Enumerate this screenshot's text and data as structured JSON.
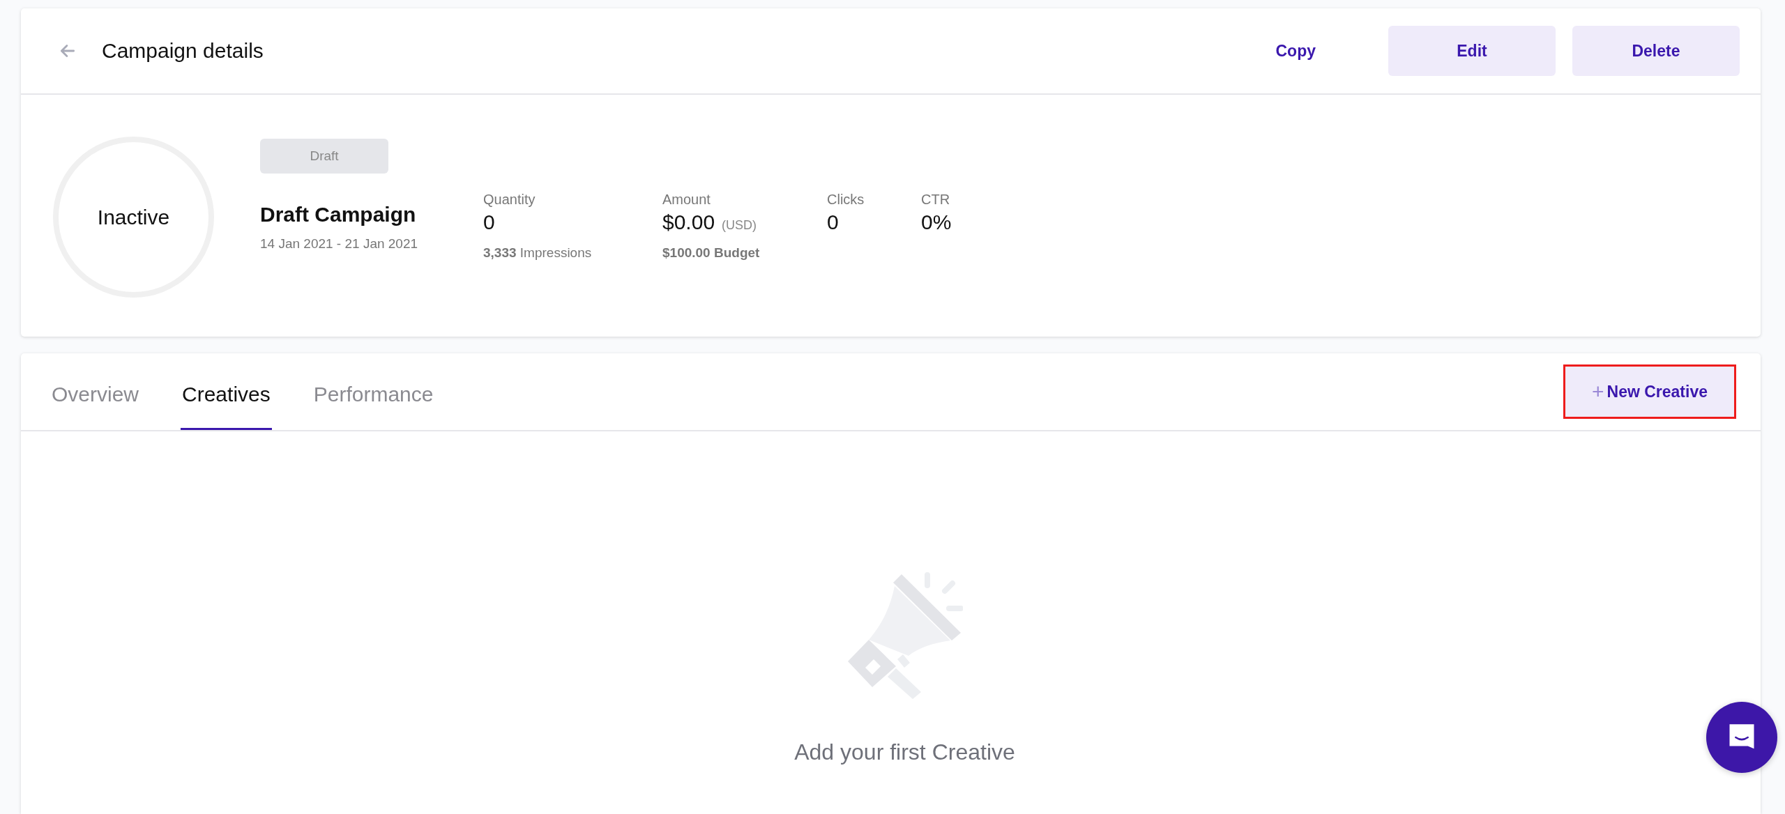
{
  "header": {
    "title": "Campaign details",
    "actions": [
      {
        "label": "Copy",
        "kind": "link"
      },
      {
        "label": "Edit",
        "kind": "button"
      },
      {
        "label": "Delete",
        "kind": "button"
      }
    ]
  },
  "campaign": {
    "status": "Inactive",
    "badge": "Draft",
    "name": "Draft Campaign",
    "dates": "14 Jan 2021 - 21 Jan 2021",
    "stats": [
      {
        "label": "Quantity",
        "value": "0",
        "sub": "**3,333** Impressions",
        "sub_bold": false
      },
      {
        "label": "Amount",
        "value": "$0.00",
        "unit": "(USD)",
        "sub": "$100.00 Budget",
        "sub_bold": true
      },
      {
        "label": "Clicks",
        "value": "0"
      },
      {
        "label": "CTR",
        "value": "0%"
      }
    ]
  },
  "tabs": [
    {
      "label": "Overview",
      "selected": false
    },
    {
      "label": "Creatives",
      "selected": true
    },
    {
      "label": "Performance",
      "selected": false
    }
  ],
  "new_button": {
    "label": "New Creative",
    "plus": "+",
    "highlighted": true
  },
  "empty_state": {
    "message": "Add your first Creative"
  }
}
